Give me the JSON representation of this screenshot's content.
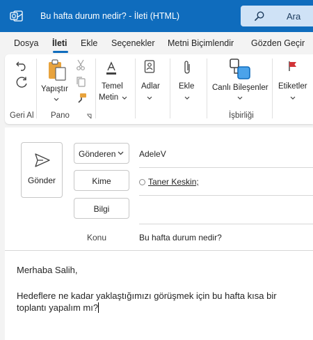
{
  "window": {
    "title": "Bu hafta durum nedir? - İleti (HTML)",
    "search_label": "Ara"
  },
  "tabs": [
    {
      "label": "Dosya"
    },
    {
      "label": "İleti"
    },
    {
      "label": "Ekle"
    },
    {
      "label": "Seçenekler"
    },
    {
      "label": "Metni Biçimlendir"
    },
    {
      "label": "Gözden Geçir"
    }
  ],
  "ribbon": {
    "undo_group": "Geri Al",
    "paste_label": "Yapıştır",
    "clipboard_group": "Pano",
    "basic_text_line1": "Temel",
    "basic_text_line2": "Metin",
    "names_label": "Adlar",
    "attach_label": "Ekle",
    "loop_label": "Canlı Bileşenler",
    "collab_group": "İşbirliği",
    "tags_label": "Etiketler"
  },
  "compose": {
    "send_label": "Gönder",
    "from_label": "Gönderen",
    "from_value": "AdeleV",
    "to_label": "Kime",
    "cc_label": "Bilgi",
    "recipient": "Taner Keskin;",
    "subject_label": "Konu",
    "subject_value": "Bu hafta durum nedir?",
    "body_greeting": "Merhaba Salih,",
    "body_line1": "Hedeflere ne kadar yaklaştığımızı görüşmek için bu hafta kısa bir",
    "body_line2": "toplantı yapalım mı?"
  },
  "colors": {
    "accent": "#0f6cbd",
    "search_bg": "#cfe2f6"
  }
}
